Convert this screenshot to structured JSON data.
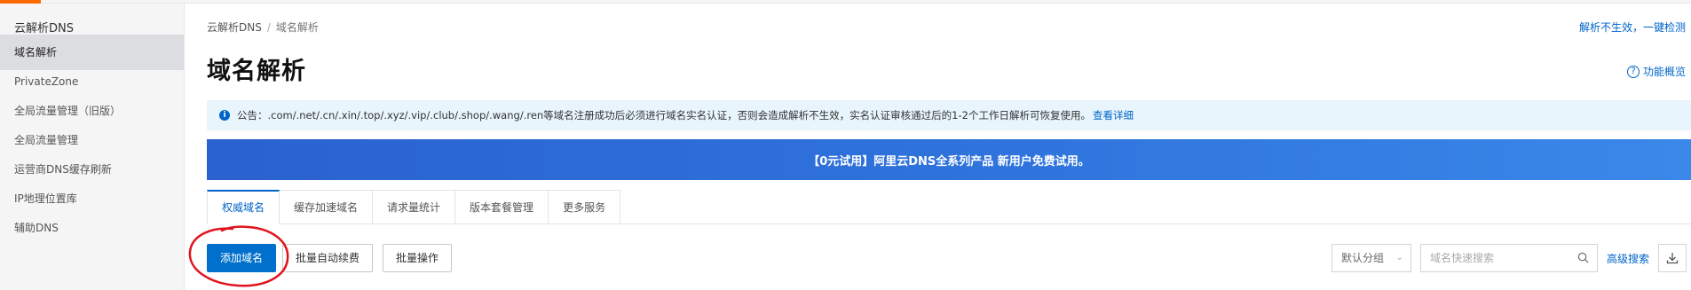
{
  "sidebar": {
    "title": "云解析DNS",
    "items": [
      {
        "label": "域名解析",
        "active": true
      },
      {
        "label": "PrivateZone"
      },
      {
        "label": "全局流量管理（旧版）"
      },
      {
        "label": "全局流量管理"
      },
      {
        "label": "运营商DNS缓存刷新"
      },
      {
        "label": "IP地理位置库"
      },
      {
        "label": "辅助DNS"
      }
    ]
  },
  "breadcrumb": {
    "root": "云解析DNS",
    "separator": "/",
    "current": "域名解析"
  },
  "header": {
    "title": "域名解析",
    "check_link": "解析不生效，一键检测",
    "overview_link": "功能概览",
    "overview_icon": "question-circle-icon"
  },
  "notice": {
    "icon": "info-icon",
    "text": "公告：.com/.net/.cn/.xin/.top/.xyz/.vip/.club/.shop/.wang/.ren等域名注册成功后必须进行域名实名认证，否则会造成解析不生效，实名认证审核通过后的1-2个工作日解析可恢复使用。",
    "more": "查看详细"
  },
  "banner": {
    "text": "【0元试用】阿里云DNS全系列产品 新用户免费试用。"
  },
  "tabs": [
    {
      "label": "权威域名",
      "active": true
    },
    {
      "label": "缓存加速域名"
    },
    {
      "label": "请求量统计"
    },
    {
      "label": "版本套餐管理"
    },
    {
      "label": "更多服务"
    }
  ],
  "toolbar": {
    "add_domain": "添加域名",
    "batch_renew": "批量自动续费",
    "batch_ops": "批量操作",
    "group_select": "默认分组",
    "search_placeholder": "域名快速搜索",
    "advanced_search": "高级搜索"
  },
  "colors": {
    "accent": "#0070cc",
    "annotation": "#e0141e",
    "banner": "#2f74dd",
    "brand": "#ff6a00"
  }
}
